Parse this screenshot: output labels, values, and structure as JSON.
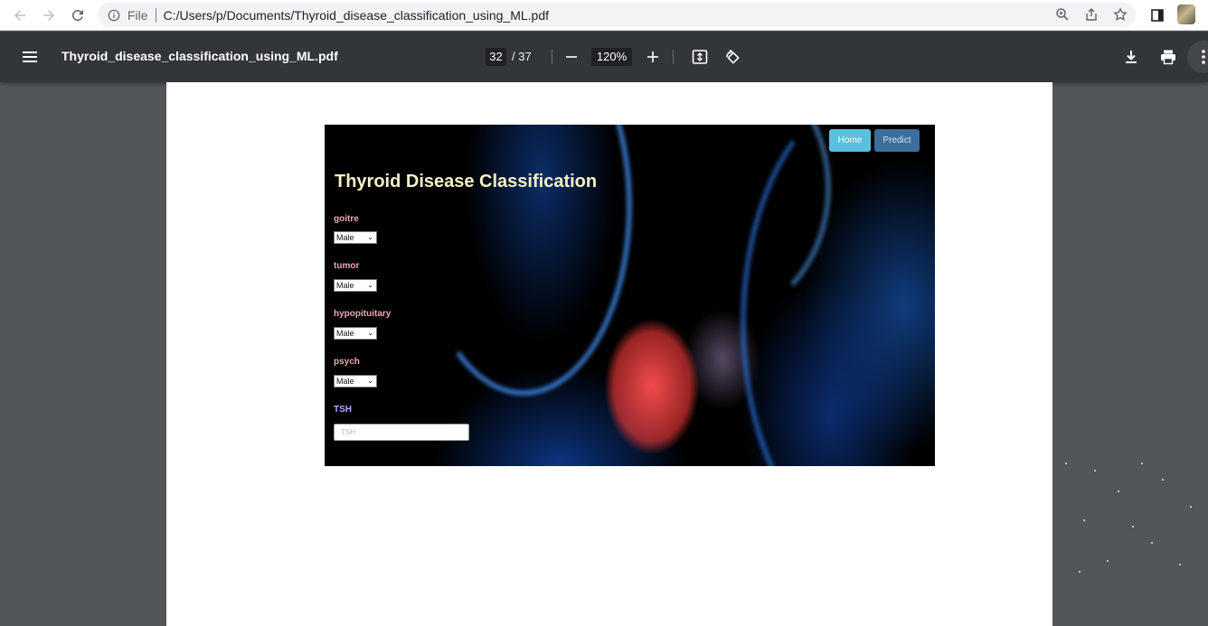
{
  "browser": {
    "scheme_label": "File",
    "url": "C:/Users/p/Documents/Thyroid_disease_classification_using_ML.pdf"
  },
  "pdf_toolbar": {
    "title": "Thyroid_disease_classification_using_ML.pdf",
    "current_page": "32",
    "total_pages": "/ 37",
    "zoom": "120%"
  },
  "webapp": {
    "nav": [
      "Home",
      "Predict"
    ],
    "title": "Thyroid Disease Classification",
    "fields": [
      {
        "label": "goitre",
        "value": "Male"
      },
      {
        "label": "tumor",
        "value": "Male"
      },
      {
        "label": "hypopituitary",
        "value": "Male"
      },
      {
        "label": "psych",
        "value": "Male"
      }
    ],
    "tsh_label": "TSH",
    "tsh_placeholder": "TSH"
  },
  "colors": {
    "pdf_toolbar": "#323639",
    "viewer_background": "#525659",
    "home_button": "#5bc0de",
    "title_text": "#f6f2c4",
    "field_label": "#f0a6b4"
  }
}
